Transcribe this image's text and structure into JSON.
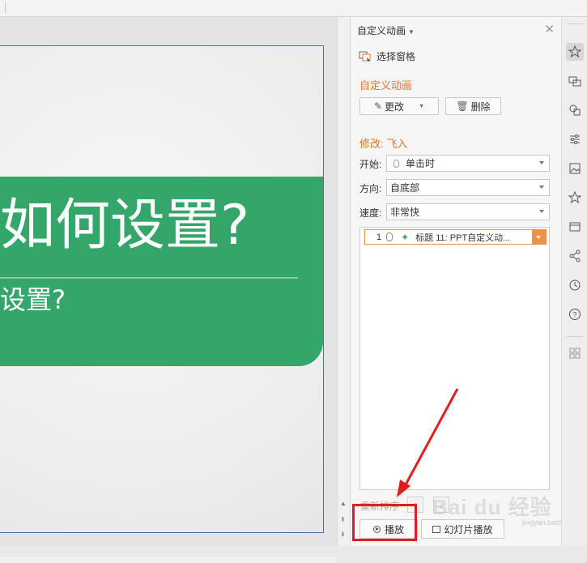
{
  "slide": {
    "title_fragment": "如何设置?",
    "subtitle_fragment": "设置?"
  },
  "pane": {
    "header": "自定义动画",
    "select_pane_label": "选择窗格",
    "custom_anim_section": "自定义动画",
    "change_button": "更改",
    "delete_button": "删除",
    "modify_section": "修改: 飞入",
    "start_label": "开始:",
    "start_value": "单击时",
    "direction_label": "方向:",
    "direction_value": "自底部",
    "speed_label": "速度:",
    "speed_value": "非常快",
    "anim_items": [
      {
        "num": "1",
        "text": "标题 11: PPT自定义动..."
      }
    ],
    "reorder_label": "重新排序",
    "play_button": "播放",
    "slideshow_button": "幻灯片播放"
  },
  "watermark": {
    "text": "Bai du 经验",
    "sub": "jingyan.baidu.com"
  },
  "colors": {
    "accent_orange": "#e2742a",
    "banner_green": "#34a66a",
    "highlight_red": "#e31d1d"
  },
  "right_strip_icons": [
    "animation-icon",
    "transition-icon",
    "shapes-icon",
    "properties-icon",
    "image-icon",
    "star-icon",
    "template-icon",
    "share-icon",
    "history-icon",
    "help-icon",
    "apps-icon"
  ]
}
